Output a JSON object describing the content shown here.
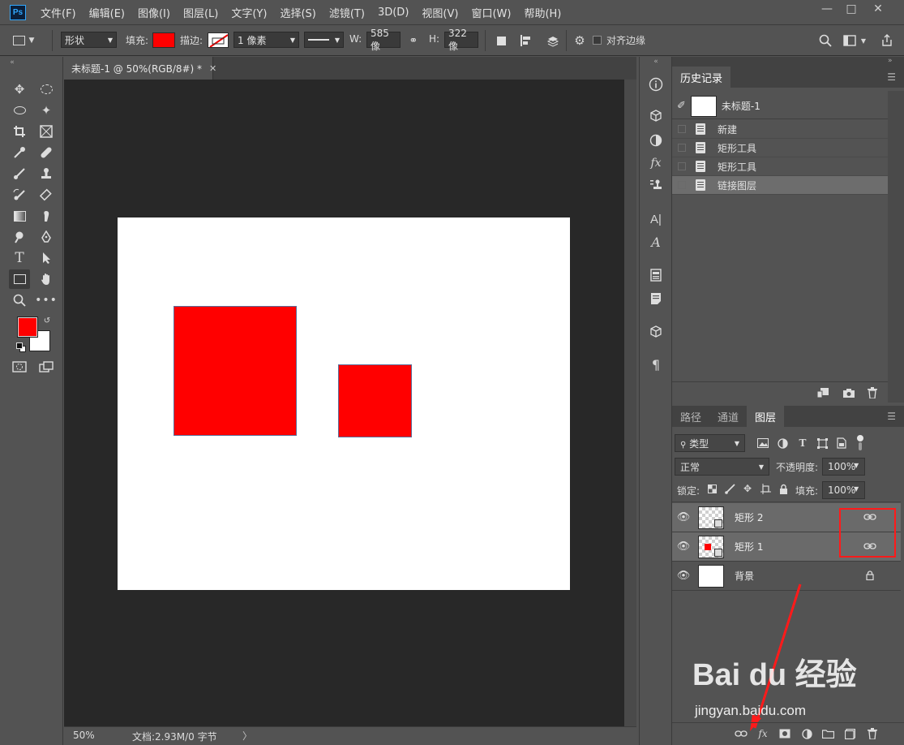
{
  "app": {
    "logo": "Ps"
  },
  "menu": [
    "文件(F)",
    "编辑(E)",
    "图像(I)",
    "图层(L)",
    "文字(Y)",
    "选择(S)",
    "滤镜(T)",
    "3D(D)",
    "视图(V)",
    "窗口(W)",
    "帮助(H)"
  ],
  "options": {
    "mode": "形状",
    "fill_label": "填充:",
    "stroke_label": "描边:",
    "stroke_width": "1 像素",
    "w_label": "W:",
    "w_value": "585 像",
    "h_label": "H:",
    "h_value": "322 像",
    "align_edges": "对齐边缘",
    "fill_color": "#ff0000"
  },
  "document": {
    "tab_title": "未标题-1 @ 50%(RGB/8#) *",
    "zoom": "50%",
    "doc_info": "文档:2.93M/0 字节"
  },
  "colors": {
    "foreground": "#ff0000",
    "background": "#ffffff"
  },
  "history": {
    "tab": "历史记录",
    "snapshot": "未标题-1",
    "items": [
      {
        "label": "新建"
      },
      {
        "label": "矩形工具"
      },
      {
        "label": "矩形工具"
      },
      {
        "label": "链接图层"
      }
    ]
  },
  "layers_panel": {
    "tabs": [
      "路径",
      "通道",
      "图层"
    ],
    "filter_type": "类型",
    "blend_mode": "正常",
    "opacity_label": "不透明度:",
    "opacity": "100%",
    "lock_label": "锁定:",
    "fill_label": "填充:",
    "fill": "100%",
    "layers": [
      {
        "name": "矩形 2"
      },
      {
        "name": "矩形 1"
      },
      {
        "name": "背景"
      }
    ]
  },
  "watermark": {
    "brand": "Bai du 经验",
    "url": "jingyan.baidu.com"
  }
}
